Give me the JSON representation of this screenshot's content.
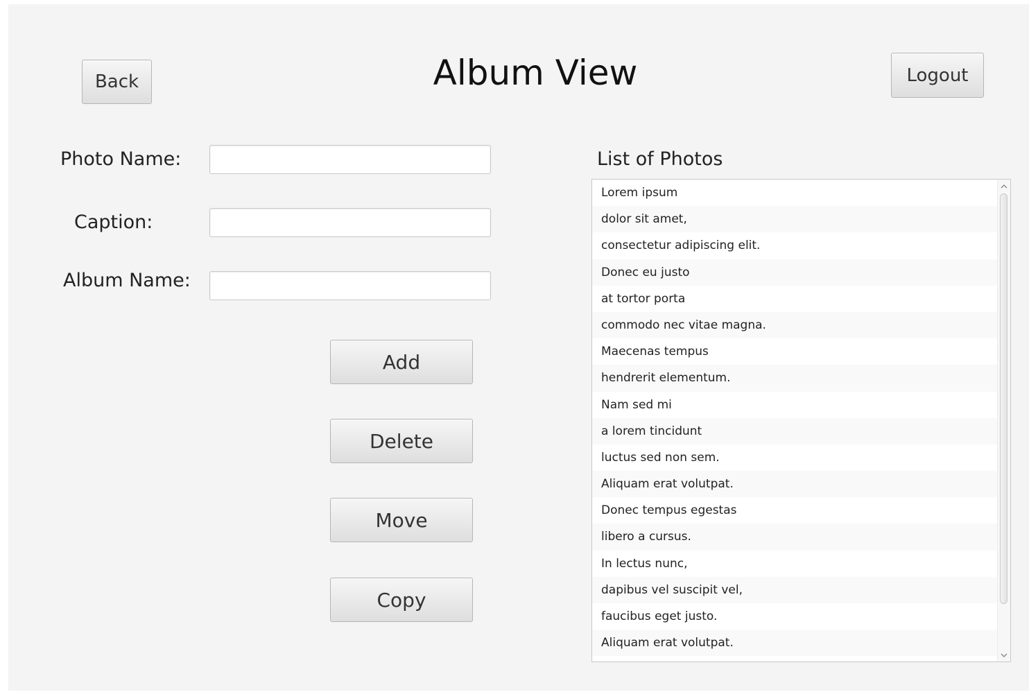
{
  "header": {
    "title": "Album View",
    "back_label": "Back",
    "logout_label": "Logout"
  },
  "form": {
    "photo_name_label": "Photo Name:",
    "caption_label": "Caption:",
    "album_name_label": "Album Name:",
    "photo_name_value": "",
    "caption_value": "",
    "album_name_value": ""
  },
  "actions": {
    "add_label": "Add",
    "delete_label": "Delete",
    "move_label": "Move",
    "copy_label": "Copy"
  },
  "photo_list": {
    "title": "List of Photos",
    "items": [
      "Lorem ipsum",
      "dolor sit amet,",
      "consectetur adipiscing elit.",
      "Donec eu justo",
      "at tortor porta",
      "commodo nec vitae magna.",
      "Maecenas tempus",
      "hendrerit elementum.",
      "Nam sed mi",
      "a lorem tincidunt",
      "luctus sed non sem.",
      "Aliquam erat volutpat.",
      "Donec tempus egestas",
      "libero a cursus.",
      "In lectus nunc,",
      "dapibus vel suscipit vel,",
      "faucibus eget justo.",
      "Aliquam erat volutpat."
    ]
  },
  "icons": {
    "scroll_up": "chevron-up-icon",
    "scroll_down": "chevron-down-icon"
  },
  "colors": {
    "window_background": "#f4f4f4",
    "button_border": "#b5b5b5",
    "list_border": "#c8c8c8"
  }
}
